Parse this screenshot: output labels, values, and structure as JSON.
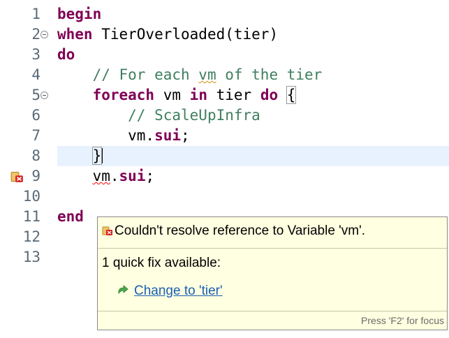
{
  "editor": {
    "lines": [
      {
        "num": "1",
        "parts": [
          {
            "t": "begin",
            "c": "kw"
          }
        ]
      },
      {
        "num": "2",
        "fold": true,
        "parts": [
          {
            "t": "when",
            "c": "kw"
          },
          {
            "t": " TierOverloaded(tier)"
          }
        ]
      },
      {
        "num": "3",
        "parts": [
          {
            "t": "do",
            "c": "kw"
          }
        ]
      },
      {
        "num": "4",
        "parts": [
          {
            "t": "    "
          },
          {
            "t": "// For each ",
            "c": "cmt"
          },
          {
            "t": "vm",
            "c": "cmt spell"
          },
          {
            "t": " of the tier",
            "c": "cmt"
          }
        ]
      },
      {
        "num": "5",
        "fold": true,
        "parts": [
          {
            "t": "    "
          },
          {
            "t": "foreach",
            "c": "kw"
          },
          {
            "t": " vm "
          },
          {
            "t": "in",
            "c": "kw"
          },
          {
            "t": " tier "
          },
          {
            "t": "do",
            "c": "kw"
          },
          {
            "t": " "
          },
          {
            "t": "{",
            "c": "bracket"
          }
        ]
      },
      {
        "num": "6",
        "parts": [
          {
            "t": "        "
          },
          {
            "t": "// ScaleUpInfra",
            "c": "cmt"
          }
        ]
      },
      {
        "num": "7",
        "parts": [
          {
            "t": "        vm."
          },
          {
            "t": "sui",
            "c": "kw"
          },
          {
            "t": ";"
          }
        ]
      },
      {
        "num": "8",
        "current": true,
        "parts": [
          {
            "t": "    "
          },
          {
            "t": "}",
            "c": "bracket"
          },
          {
            "t": "",
            "c": "caret"
          }
        ]
      },
      {
        "num": "9",
        "error": true,
        "parts": [
          {
            "t": "    "
          },
          {
            "t": "vm",
            "c": "err"
          },
          {
            "t": "."
          },
          {
            "t": "sui",
            "c": "kw"
          },
          {
            "t": ";"
          }
        ]
      },
      {
        "num": "10",
        "parts": []
      },
      {
        "num": "11",
        "parts": [
          {
            "t": "end",
            "c": "kw"
          }
        ]
      },
      {
        "num": "12",
        "parts": []
      },
      {
        "num": "13",
        "parts": []
      }
    ]
  },
  "hover": {
    "message": "Couldn't resolve reference to Variable 'vm'.",
    "quickfix_count": "1 quick fix available:",
    "fix_label": "Change to 'tier'",
    "footer": "Press 'F2' for focus"
  },
  "colors": {
    "keyword": "#7f0055",
    "comment": "#3f7f5f",
    "current_line": "#e8f2fe",
    "hover_bg": "#ffffe1",
    "link": "#1a5fb4",
    "error": "#ff0000"
  },
  "icons": {
    "error_marker": "error-lightbulb-icon",
    "fold": "fold-toggle-icon",
    "quickfix": "quickfix-arrow-icon"
  }
}
